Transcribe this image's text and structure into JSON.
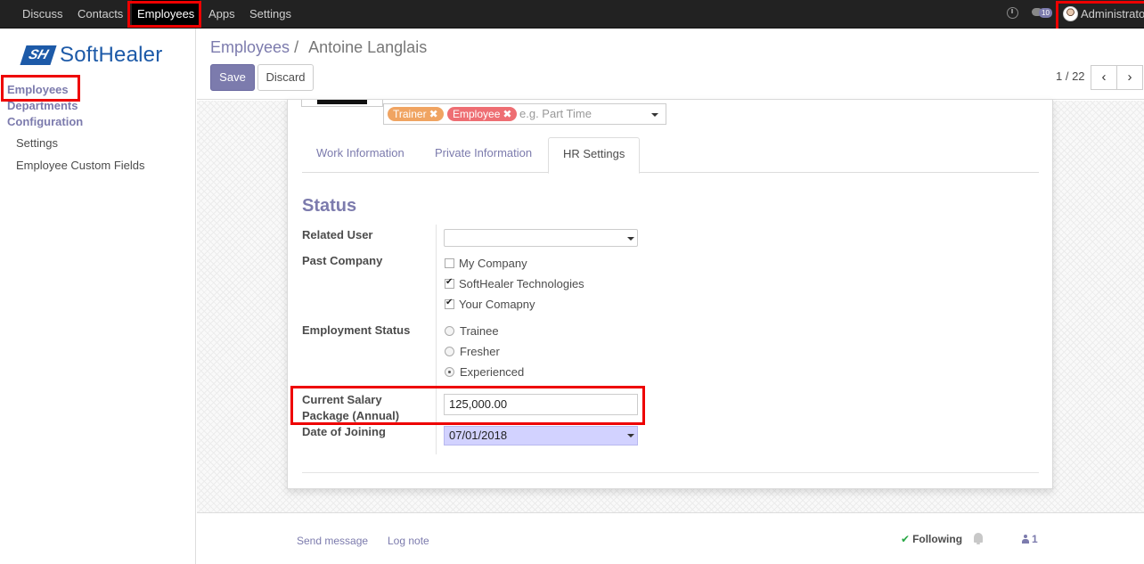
{
  "navbar": {
    "items": [
      "Discuss",
      "Contacts",
      "Employees",
      "Apps",
      "Settings"
    ],
    "active": "Employees",
    "messages_count": "10",
    "user_name": "Administrator"
  },
  "sidebar": {
    "logo_mark": "SH",
    "logo_text": "SoftHealer",
    "menu_employees": "Employees",
    "menu_departments": "Departments",
    "menu_configuration": "Configuration",
    "sub_settings": "Settings",
    "sub_custom_fields": "Employee Custom Fields"
  },
  "control_panel": {
    "breadcrumb_parent": "Employees",
    "breadcrumb_separator": "/",
    "breadcrumb_current": "Antoine Langlais",
    "save_label": "Save",
    "discard_label": "Discard",
    "pager": "1 / 22"
  },
  "form": {
    "tags": [
      {
        "label": "Trainer",
        "color": "#f0a462"
      },
      {
        "label": "Employee",
        "color": "#ee6e73"
      }
    ],
    "tags_placeholder": "e.g. Part Time",
    "tabs": [
      "Work Information",
      "Private Information",
      "HR Settings"
    ],
    "active_tab": "HR Settings",
    "section_title": "Status",
    "related_user_label": "Related User",
    "related_user_value": "",
    "past_company_label": "Past Company",
    "past_companies": [
      {
        "label": "My Company",
        "checked": false
      },
      {
        "label": "SoftHealer Technologies",
        "checked": true
      },
      {
        "label": "Your Comapny",
        "checked": true
      }
    ],
    "employment_status_label": "Employment Status",
    "employment_statuses": [
      {
        "label": "Trainee",
        "selected": false
      },
      {
        "label": "Fresher",
        "selected": false
      },
      {
        "label": "Experienced",
        "selected": true
      }
    ],
    "salary_label_line1": "Current Salary",
    "salary_label_line2": "Package (Annual)",
    "salary_value": "125,000.00",
    "joining_label": "Date of Joining",
    "joining_value": "07/01/2018"
  },
  "chatter": {
    "send_message": "Send message",
    "log_note": "Log note",
    "following": "Following",
    "followers_count": "1"
  },
  "colors": {
    "brand": "#7c7bad",
    "highlight_box": "#e00000",
    "navbar_bg": "#222222"
  }
}
